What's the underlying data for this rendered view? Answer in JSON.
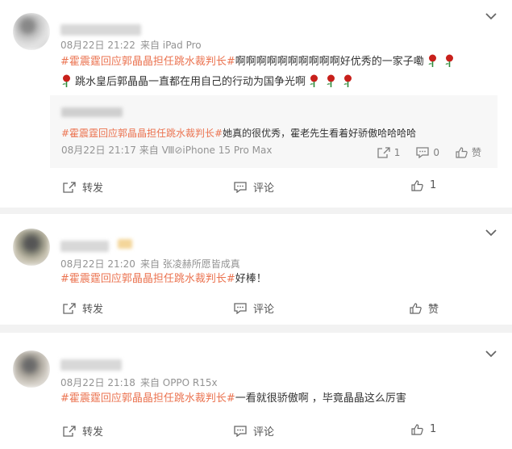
{
  "colors": {
    "topic": "#eb7350",
    "meta": "#939393",
    "rose": "#c8201b"
  },
  "comments": [
    {
      "time": "08月22日 21:22",
      "source": "来自 iPad Pro",
      "topic": "#霍震霆回应郭晶晶担任跳水裁判长#",
      "text": "啊啊啊啊啊啊啊啊啊啊好优秀的一家子嘞",
      "text2": "跳水皇后郭晶晶一直都在用自己的行动为国争光啊",
      "quote": {
        "text": "她真的很优秀，霍老先生看着好骄傲哈哈哈哈",
        "topic": "#霍震霆回应郭晶晶担任跳水裁判长#",
        "meta": "08月22日 21:17 来自 Ⅷ⊘iPhone 15 Pro Max",
        "repost_count": "1",
        "comment_count": "0",
        "like_label": "赞"
      },
      "actions": {
        "repost": "转发",
        "comment": "评论",
        "like": "1"
      }
    },
    {
      "time": "08月22日 21:20",
      "source": "来自 张凌赫所愿皆成真",
      "topic": "#霍震霆回应郭晶晶担任跳水裁判长#",
      "text": "好棒！",
      "actions": {
        "repost": "转发",
        "comment": "评论",
        "like": "赞"
      }
    },
    {
      "time": "08月22日 21:18",
      "source": "来自 OPPO R15x",
      "topic": "#霍震霆回应郭晶晶担任跳水裁判长#",
      "text": "一看就很骄傲啊 ，毕竟晶晶这么厉害",
      "actions": {
        "repost": "转发",
        "comment": "评论",
        "like": "1"
      }
    }
  ]
}
